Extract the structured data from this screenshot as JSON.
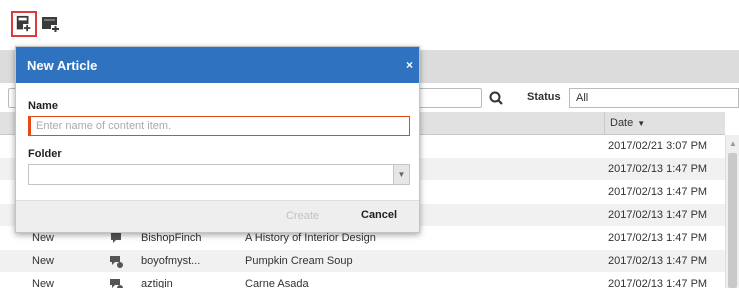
{
  "toolbar": {
    "new_article_icon": "new-article-icon",
    "new_media_icon": "new-media-icon",
    "active_highlight_color": "#e03a3a"
  },
  "filters": {
    "search_value": "",
    "status_label": "Status",
    "status_value": "All"
  },
  "grid": {
    "date_header": "Date",
    "rows": [
      {
        "status": "",
        "icon": "",
        "author": "",
        "title": "",
        "date": "2017/02/21 3:07 PM"
      },
      {
        "status": "",
        "icon": "",
        "author": "",
        "title": "",
        "date": "2017/02/13 1:47 PM"
      },
      {
        "status": "",
        "icon": "",
        "author": "",
        "title": "",
        "date": "2017/02/13 1:47 PM"
      },
      {
        "status": "",
        "icon": "",
        "author": "",
        "title": "",
        "date": "2017/02/13 1:47 PM"
      },
      {
        "status": "New",
        "icon": "article-icon",
        "author": "BishopFinch",
        "title": "A History of Interior Design",
        "date": "2017/02/13 1:47 PM"
      },
      {
        "status": "New",
        "icon": "recipe-icon",
        "author": "boyofmyst...",
        "title": "Pumpkin Cream Soup",
        "date": "2017/02/13 1:47 PM"
      },
      {
        "status": "New",
        "icon": "recipe-icon",
        "author": "aztigin",
        "title": "Carne Asada",
        "date": "2017/02/13 1:47 PM"
      }
    ]
  },
  "dialog": {
    "title": "New Article",
    "close": "×",
    "name_label": "Name",
    "name_value": "",
    "name_placeholder": "Enter name of content item.",
    "folder_label": "Folder",
    "folder_value": "",
    "create_label": "Create",
    "cancel_label": "Cancel",
    "header_color": "#2f72c0"
  }
}
